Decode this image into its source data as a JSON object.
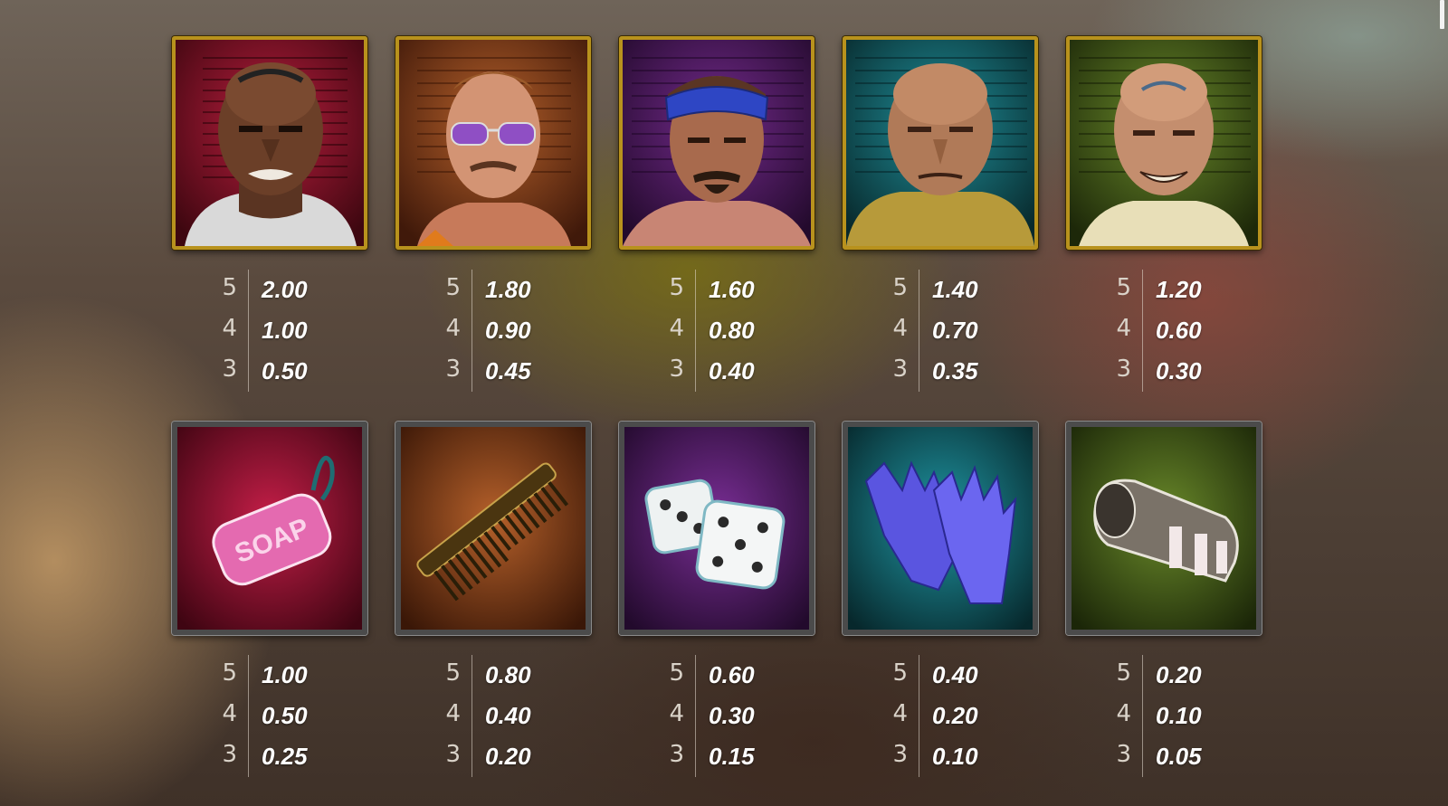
{
  "characters": [
    {
      "name": "tattooed-inmate-red",
      "bg": "#8e1530",
      "bg_dark": "#3e0710",
      "payouts": [
        {
          "count": "5",
          "value": "2.00"
        },
        {
          "count": "4",
          "value": "1.00"
        },
        {
          "count": "3",
          "value": "0.50"
        }
      ]
    },
    {
      "name": "sunglasses-inmate-orange",
      "bg": "#9a4a1c",
      "bg_dark": "#40190a",
      "payouts": [
        {
          "count": "5",
          "value": "1.80"
        },
        {
          "count": "4",
          "value": "0.90"
        },
        {
          "count": "3",
          "value": "0.45"
        }
      ]
    },
    {
      "name": "bandana-inmate-purple",
      "bg": "#5a1f6d",
      "bg_dark": "#230a2c",
      "payouts": [
        {
          "count": "5",
          "value": "1.60"
        },
        {
          "count": "4",
          "value": "0.80"
        },
        {
          "count": "3",
          "value": "0.40"
        }
      ]
    },
    {
      "name": "bald-inmate-teal",
      "bg": "#17707a",
      "bg_dark": "#08292c",
      "payouts": [
        {
          "count": "5",
          "value": "1.40"
        },
        {
          "count": "4",
          "value": "0.70"
        },
        {
          "count": "3",
          "value": "0.35"
        }
      ]
    },
    {
      "name": "lucky-inmate-green",
      "bg": "#4f6a1e",
      "bg_dark": "#1d2809",
      "payouts": [
        {
          "count": "5",
          "value": "1.20"
        },
        {
          "count": "4",
          "value": "0.60"
        },
        {
          "count": "3",
          "value": "0.30"
        }
      ]
    }
  ],
  "items": [
    {
      "name": "soap",
      "label": "SOAP",
      "bg": "#a8163a",
      "bg_dark": "#3f0512",
      "payouts": [
        {
          "count": "5",
          "value": "1.00"
        },
        {
          "count": "4",
          "value": "0.50"
        },
        {
          "count": "3",
          "value": "0.25"
        }
      ]
    },
    {
      "name": "comb",
      "bg": "#9a4a1c",
      "bg_dark": "#3a1707",
      "payouts": [
        {
          "count": "5",
          "value": "0.80"
        },
        {
          "count": "4",
          "value": "0.40"
        },
        {
          "count": "3",
          "value": "0.20"
        }
      ]
    },
    {
      "name": "dice",
      "bg": "#5e2275",
      "bg_dark": "#220a2c",
      "payouts": [
        {
          "count": "5",
          "value": "0.60"
        },
        {
          "count": "4",
          "value": "0.30"
        },
        {
          "count": "3",
          "value": "0.15"
        }
      ]
    },
    {
      "name": "gloves",
      "bg": "#177581",
      "bg_dark": "#07282c",
      "payouts": [
        {
          "count": "5",
          "value": "0.40"
        },
        {
          "count": "4",
          "value": "0.20"
        },
        {
          "count": "3",
          "value": "0.10"
        }
      ]
    },
    {
      "name": "sock",
      "bg": "#4f6a1e",
      "bg_dark": "#1b2608",
      "payouts": [
        {
          "count": "5",
          "value": "0.20"
        },
        {
          "count": "4",
          "value": "0.10"
        },
        {
          "count": "3",
          "value": "0.05"
        }
      ]
    }
  ]
}
